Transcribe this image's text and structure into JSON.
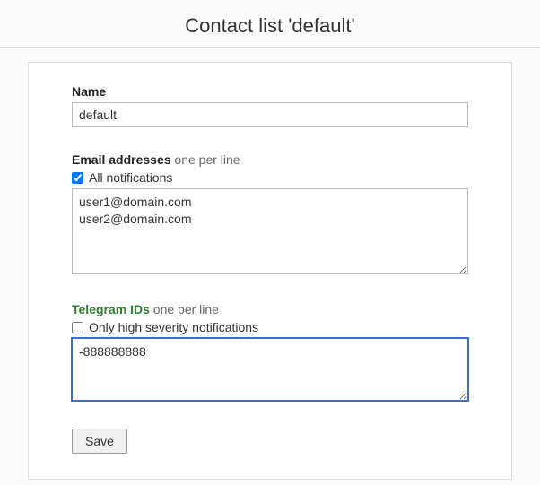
{
  "header": {
    "title": "Contact list 'default'"
  },
  "form": {
    "name": {
      "label": "Name",
      "value": "default"
    },
    "email": {
      "label": "Email addresses",
      "hint": "one per line",
      "checkbox_label": "All notifications",
      "checkbox_checked": true,
      "value": "user1@domain.com\nuser2@domain.com"
    },
    "telegram": {
      "label": "Telegram IDs",
      "hint": "one per line",
      "checkbox_label": "Only high severity notifications",
      "checkbox_checked": false,
      "value": "-888888888"
    },
    "save_label": "Save"
  }
}
